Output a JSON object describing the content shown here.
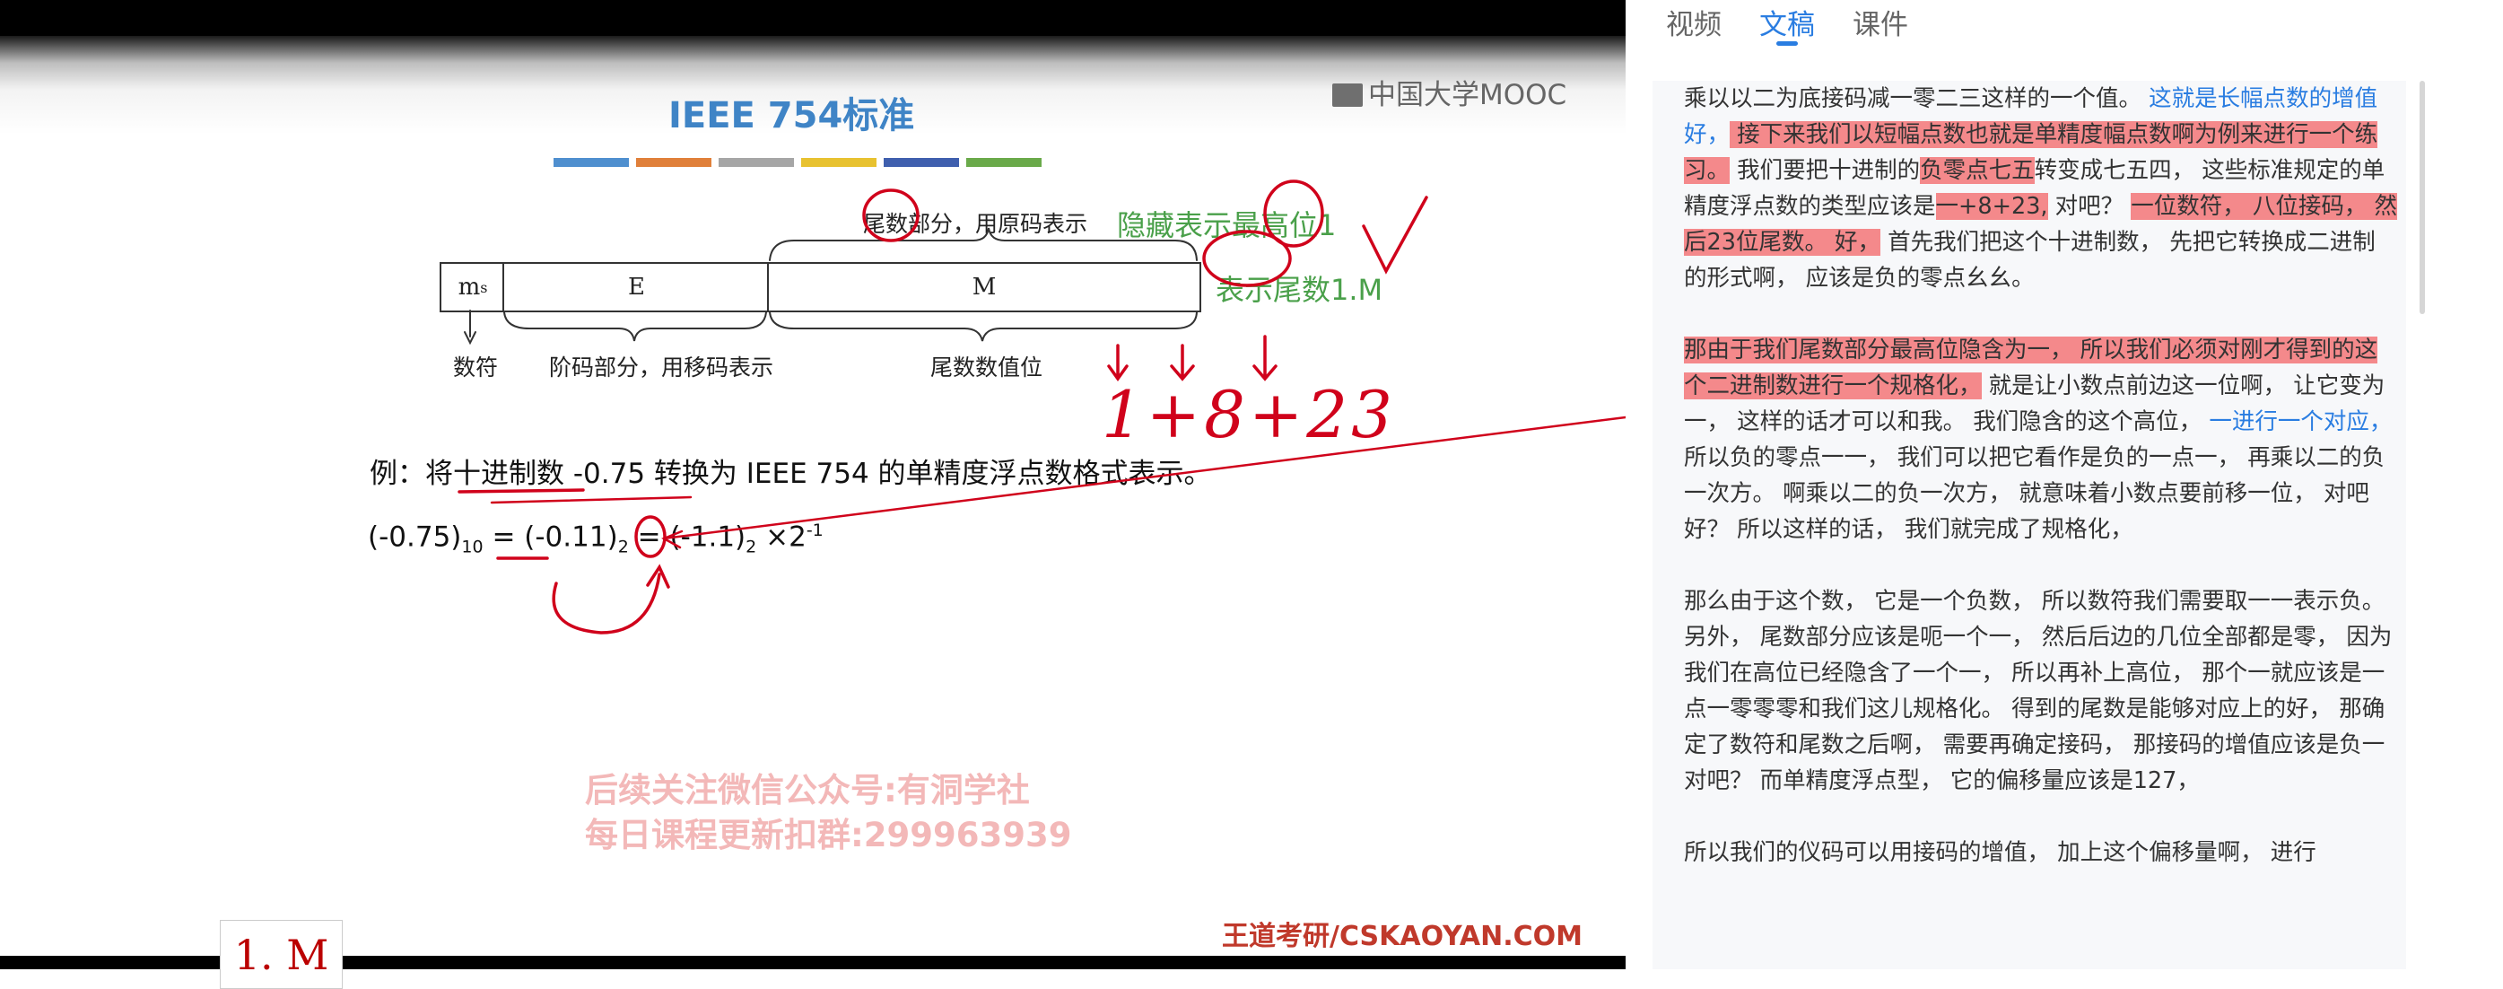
{
  "slide": {
    "title": "IEEE 754标准",
    "logo": "中国大学MOOC",
    "label_mantissa_top": "尾数部分，用原码表示",
    "note_hidden_bit": "隐藏表示最高位1",
    "note_mantissa_form": "表示尾数1.M",
    "cell_ms": "m",
    "cell_ms_sub": "s",
    "cell_e": "E",
    "cell_m": "M",
    "label_sign": "数符",
    "label_exponent": "阶码部分，用移码表示",
    "label_mantissa_value": "尾数数值位",
    "handwritten_sum": "1+8+23",
    "example": "例：将十进制数 -0.75 转换为 IEEE 754 的单精度浮点数格式表示。",
    "eq_left": "(-0.75)",
    "eq_left_sub": "10",
    "eq_mid": "= (-0.11)",
    "eq_mid_sub": "2",
    "eq_right": "= (-1.1)",
    "eq_right_sub": "2",
    "eq_tail": "×2",
    "eq_tail_sup": "-1",
    "watermark_1": "后续关注微信公众号:有洞学社",
    "watermark_2": "每日课程更新扣群:299963939",
    "footer_brand": "王道考研/CSKAOYAN.COM",
    "thumb_text": "1. M",
    "color_bars": [
      "#4f8fcf",
      "#e0803a",
      "#a6a6a6",
      "#e8c230",
      "#3f5fae",
      "#6aaa4a"
    ]
  },
  "tabs": [
    {
      "label": "视频"
    },
    {
      "label": "文稿"
    },
    {
      "label": "课件"
    }
  ],
  "active_tab": "文稿",
  "transcript": {
    "p1": [
      {
        "t": "乘以以二为底接码减一零二三这样的一个值。 ",
        "s": ""
      },
      {
        "t": "这就是长幅点数的增值好，",
        "s": "blue"
      },
      {
        "t": " 接下来我们以短幅点数也就是单精度幅点数啊为例来进行一个练习。",
        "s": "hl"
      },
      {
        "t": " 我们要把十进制的",
        "s": ""
      },
      {
        "t": "负零点七五",
        "s": "hl"
      },
      {
        "t": "转变成七五四， 这些标准规定的单精度浮点数的类型应该是",
        "s": ""
      },
      {
        "t": "一+8+23,",
        "s": "hl"
      },
      {
        "t": " 对吧？ ",
        "s": ""
      },
      {
        "t": "一位数符， 八位接码， 然后23位尾数。 好，",
        "s": "hl"
      },
      {
        "t": " 首先我们把这个十进制数， 先把它转换成二进制的形式啊， 应该是负的零点幺幺。",
        "s": ""
      }
    ],
    "p2": [
      {
        "t": "那由于我们尾数部分最高位隐含为一， 所以我们必须对刚才得到的这个二进制数进行一个规格化，",
        "s": "hl"
      },
      {
        "t": " 就是让小数点前边这一位啊， 让它变为一， 这样的话才可以和我。 我们隐含的这个高位， ",
        "s": ""
      },
      {
        "t": "一进行一个对应，",
        "s": "blue"
      },
      {
        "t": " 所以负的零点一一， 我们可以把它看作是负的一点一， 再乘以二的负一次方。 啊乘以二的负一次方， 就意味着小数点要前移一位， 对吧好？ 所以这样的话， 我们就完成了规格化，",
        "s": ""
      }
    ],
    "p3": [
      {
        "t": "那么由于这个数， 它是一个负数， 所以数符我们需要取一一表示负。 另外， 尾数部分应该是呃一个一， 然后后边的几位全部都是零， 因为我们在高位已经隐含了一个一， 所以再补上高位， 那个一就应该是一点一零零零和我们这儿规格化。 得到的尾数是能够对应上的好， 那确定了数符和尾数之后啊， 需要再确定接码， 那接码的增值应该是负一对吧？ 而单精度浮点型， 它的偏移量应该是127，",
        "s": ""
      }
    ],
    "p4": [
      {
        "t": "所以我们的仪码可以用接码的增值， 加上这个偏移量啊， 进行",
        "s": ""
      }
    ]
  }
}
